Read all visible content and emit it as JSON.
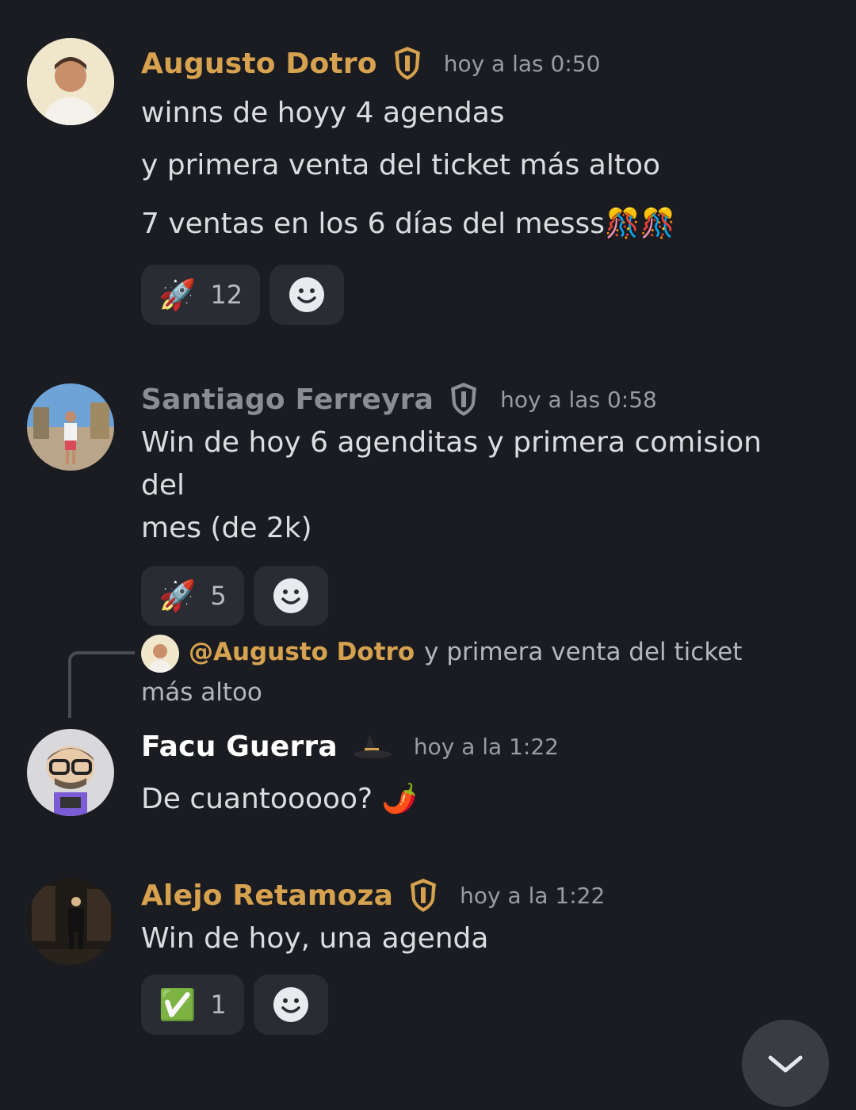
{
  "messages": [
    {
      "author": "Augusto Dotro",
      "timestamp": "hoy a las 0:50",
      "badge_icon": "shield-gold-icon",
      "lines": [
        "winns de hoyy 4 agendas",
        "y primera venta del ticket más altoo",
        "7 ventas en los 6 días del messs🎊🎊"
      ],
      "reactions": [
        {
          "emoji": "🚀",
          "count": "12"
        }
      ]
    },
    {
      "author": "Santiago Ferreyra",
      "timestamp": "hoy a las 0:58",
      "badge_icon": "shield-dark-icon",
      "lines": [
        "Win de hoy 6 agenditas y primera comision del",
        "mes (de 2k)"
      ],
      "reactions": [
        {
          "emoji": "🚀",
          "count": "5"
        }
      ]
    },
    {
      "reply_to": {
        "mention": "@Augusto Dotro",
        "text": "y primera venta del ticket más altoo"
      },
      "author": "Facu Guerra",
      "timestamp": "hoy a la 1:22",
      "badge_icon": "witch-hat-icon",
      "lines": [
        "De cuantooooo? 🌶️"
      ]
    },
    {
      "author": "Alejo Retamoza",
      "timestamp": "hoy a la 1:22",
      "badge_icon": "shield-gold-icon",
      "lines": [
        "Win de hoy, una agenda"
      ],
      "reactions": [
        {
          "emoji": "✅",
          "count": "1"
        }
      ]
    }
  ],
  "colors": {
    "background": "#1b1c21",
    "gold_name": "#d6a24f",
    "reaction_bg": "#2a2c33"
  },
  "icons": {
    "add_reaction": "smiley-add-reaction-icon",
    "scroll_down": "chevron-down-icon"
  }
}
